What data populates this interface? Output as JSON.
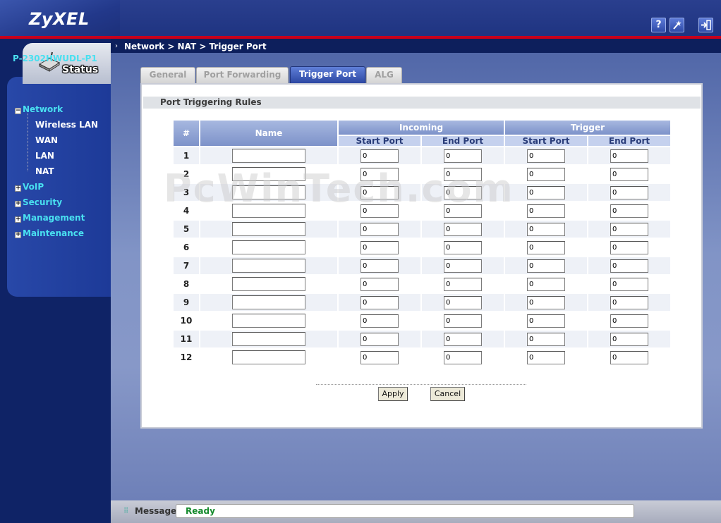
{
  "header": {
    "logo": "ZyXEL",
    "help_icon": "?",
    "wizard_icon": "wand-icon",
    "logout_icon": "logout-icon"
  },
  "nav": {
    "status_label": "Status",
    "device_name": "P-2302HWUDL-P1",
    "items": [
      {
        "label": "Network",
        "expanded": true
      },
      {
        "label": "Wireless LAN"
      },
      {
        "label": "WAN"
      },
      {
        "label": "LAN"
      },
      {
        "label": "NAT"
      },
      {
        "label": "VoIP",
        "expanded": false
      },
      {
        "label": "Security",
        "expanded": false
      },
      {
        "label": "Management",
        "expanded": false
      },
      {
        "label": "Maintenance",
        "expanded": false
      }
    ]
  },
  "breadcrumb": "Network > NAT > Trigger Port",
  "tabs": [
    {
      "label": "General"
    },
    {
      "label": "Port Forwarding"
    },
    {
      "label": "Trigger Port",
      "active": true
    },
    {
      "label": "ALG"
    }
  ],
  "section_title": "Port Triggering Rules",
  "table": {
    "headers": {
      "num": "#",
      "name": "Name",
      "incoming": "Incoming",
      "trigger": "Trigger",
      "start": "Start Port",
      "end": "End Port"
    },
    "rows": [
      {
        "num": "1",
        "name": "",
        "in_start": "0",
        "in_end": "0",
        "tr_start": "0",
        "tr_end": "0"
      },
      {
        "num": "2",
        "name": "",
        "in_start": "0",
        "in_end": "0",
        "tr_start": "0",
        "tr_end": "0"
      },
      {
        "num": "3",
        "name": "",
        "in_start": "0",
        "in_end": "0",
        "tr_start": "0",
        "tr_end": "0"
      },
      {
        "num": "4",
        "name": "",
        "in_start": "0",
        "in_end": "0",
        "tr_start": "0",
        "tr_end": "0"
      },
      {
        "num": "5",
        "name": "",
        "in_start": "0",
        "in_end": "0",
        "tr_start": "0",
        "tr_end": "0"
      },
      {
        "num": "6",
        "name": "",
        "in_start": "0",
        "in_end": "0",
        "tr_start": "0",
        "tr_end": "0"
      },
      {
        "num": "7",
        "name": "",
        "in_start": "0",
        "in_end": "0",
        "tr_start": "0",
        "tr_end": "0"
      },
      {
        "num": "8",
        "name": "",
        "in_start": "0",
        "in_end": "0",
        "tr_start": "0",
        "tr_end": "0"
      },
      {
        "num": "9",
        "name": "",
        "in_start": "0",
        "in_end": "0",
        "tr_start": "0",
        "tr_end": "0"
      },
      {
        "num": "10",
        "name": "",
        "in_start": "0",
        "in_end": "0",
        "tr_start": "0",
        "tr_end": "0"
      },
      {
        "num": "11",
        "name": "",
        "in_start": "0",
        "in_end": "0",
        "tr_start": "0",
        "tr_end": "0"
      },
      {
        "num": "12",
        "name": "",
        "in_start": "0",
        "in_end": "0",
        "tr_start": "0",
        "tr_end": "0"
      }
    ]
  },
  "buttons": {
    "apply": "Apply",
    "cancel": "Cancel"
  },
  "watermark": "PcWinTech.com",
  "status": {
    "label": "Message",
    "value": "Ready"
  }
}
